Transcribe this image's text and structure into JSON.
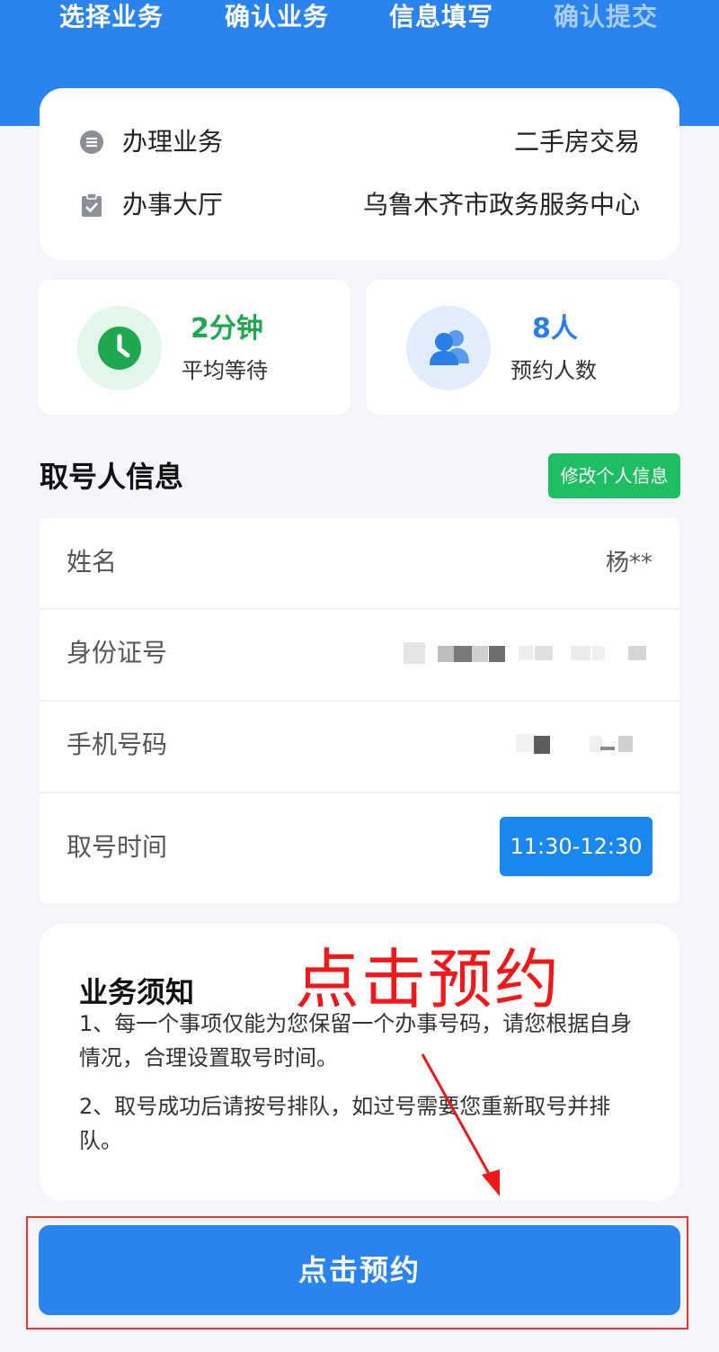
{
  "steps": [
    {
      "label": "选择业务",
      "active": true
    },
    {
      "label": "确认业务",
      "active": true
    },
    {
      "label": "信息填写",
      "active": true
    },
    {
      "label": "确认提交",
      "active": false
    }
  ],
  "business": {
    "service_label": "办理业务",
    "service_value": "二手房交易",
    "hall_label": "办事大厅",
    "hall_value": "乌鲁木齐市政务服务中心"
  },
  "stats": {
    "wait_value": "2分钟",
    "wait_label": "平均等待",
    "people_value": "8人",
    "people_label": "预约人数"
  },
  "applicant": {
    "section_title": "取号人信息",
    "edit_button": "修改个人信息",
    "name_label": "姓名",
    "name_value": "杨**",
    "id_label": "身份证号",
    "phone_label": "手机号码",
    "time_label": "取号时间",
    "time_value": "11:30-12:30"
  },
  "notice": {
    "title": "业务须知",
    "item1": "1、每一个事项仅能为您保留一个办事号码，请您根据自身情况，合理设置取号时间。",
    "item2": "2、取号成功后请按号排队，如过号需要您重新取号并排队。"
  },
  "annotation": {
    "text": "点击预约"
  },
  "submit": {
    "label": "点击预约"
  },
  "colors": {
    "brand_blue": "#2a84f0",
    "green": "#1fbe62",
    "annotation_red": "#f01818"
  }
}
